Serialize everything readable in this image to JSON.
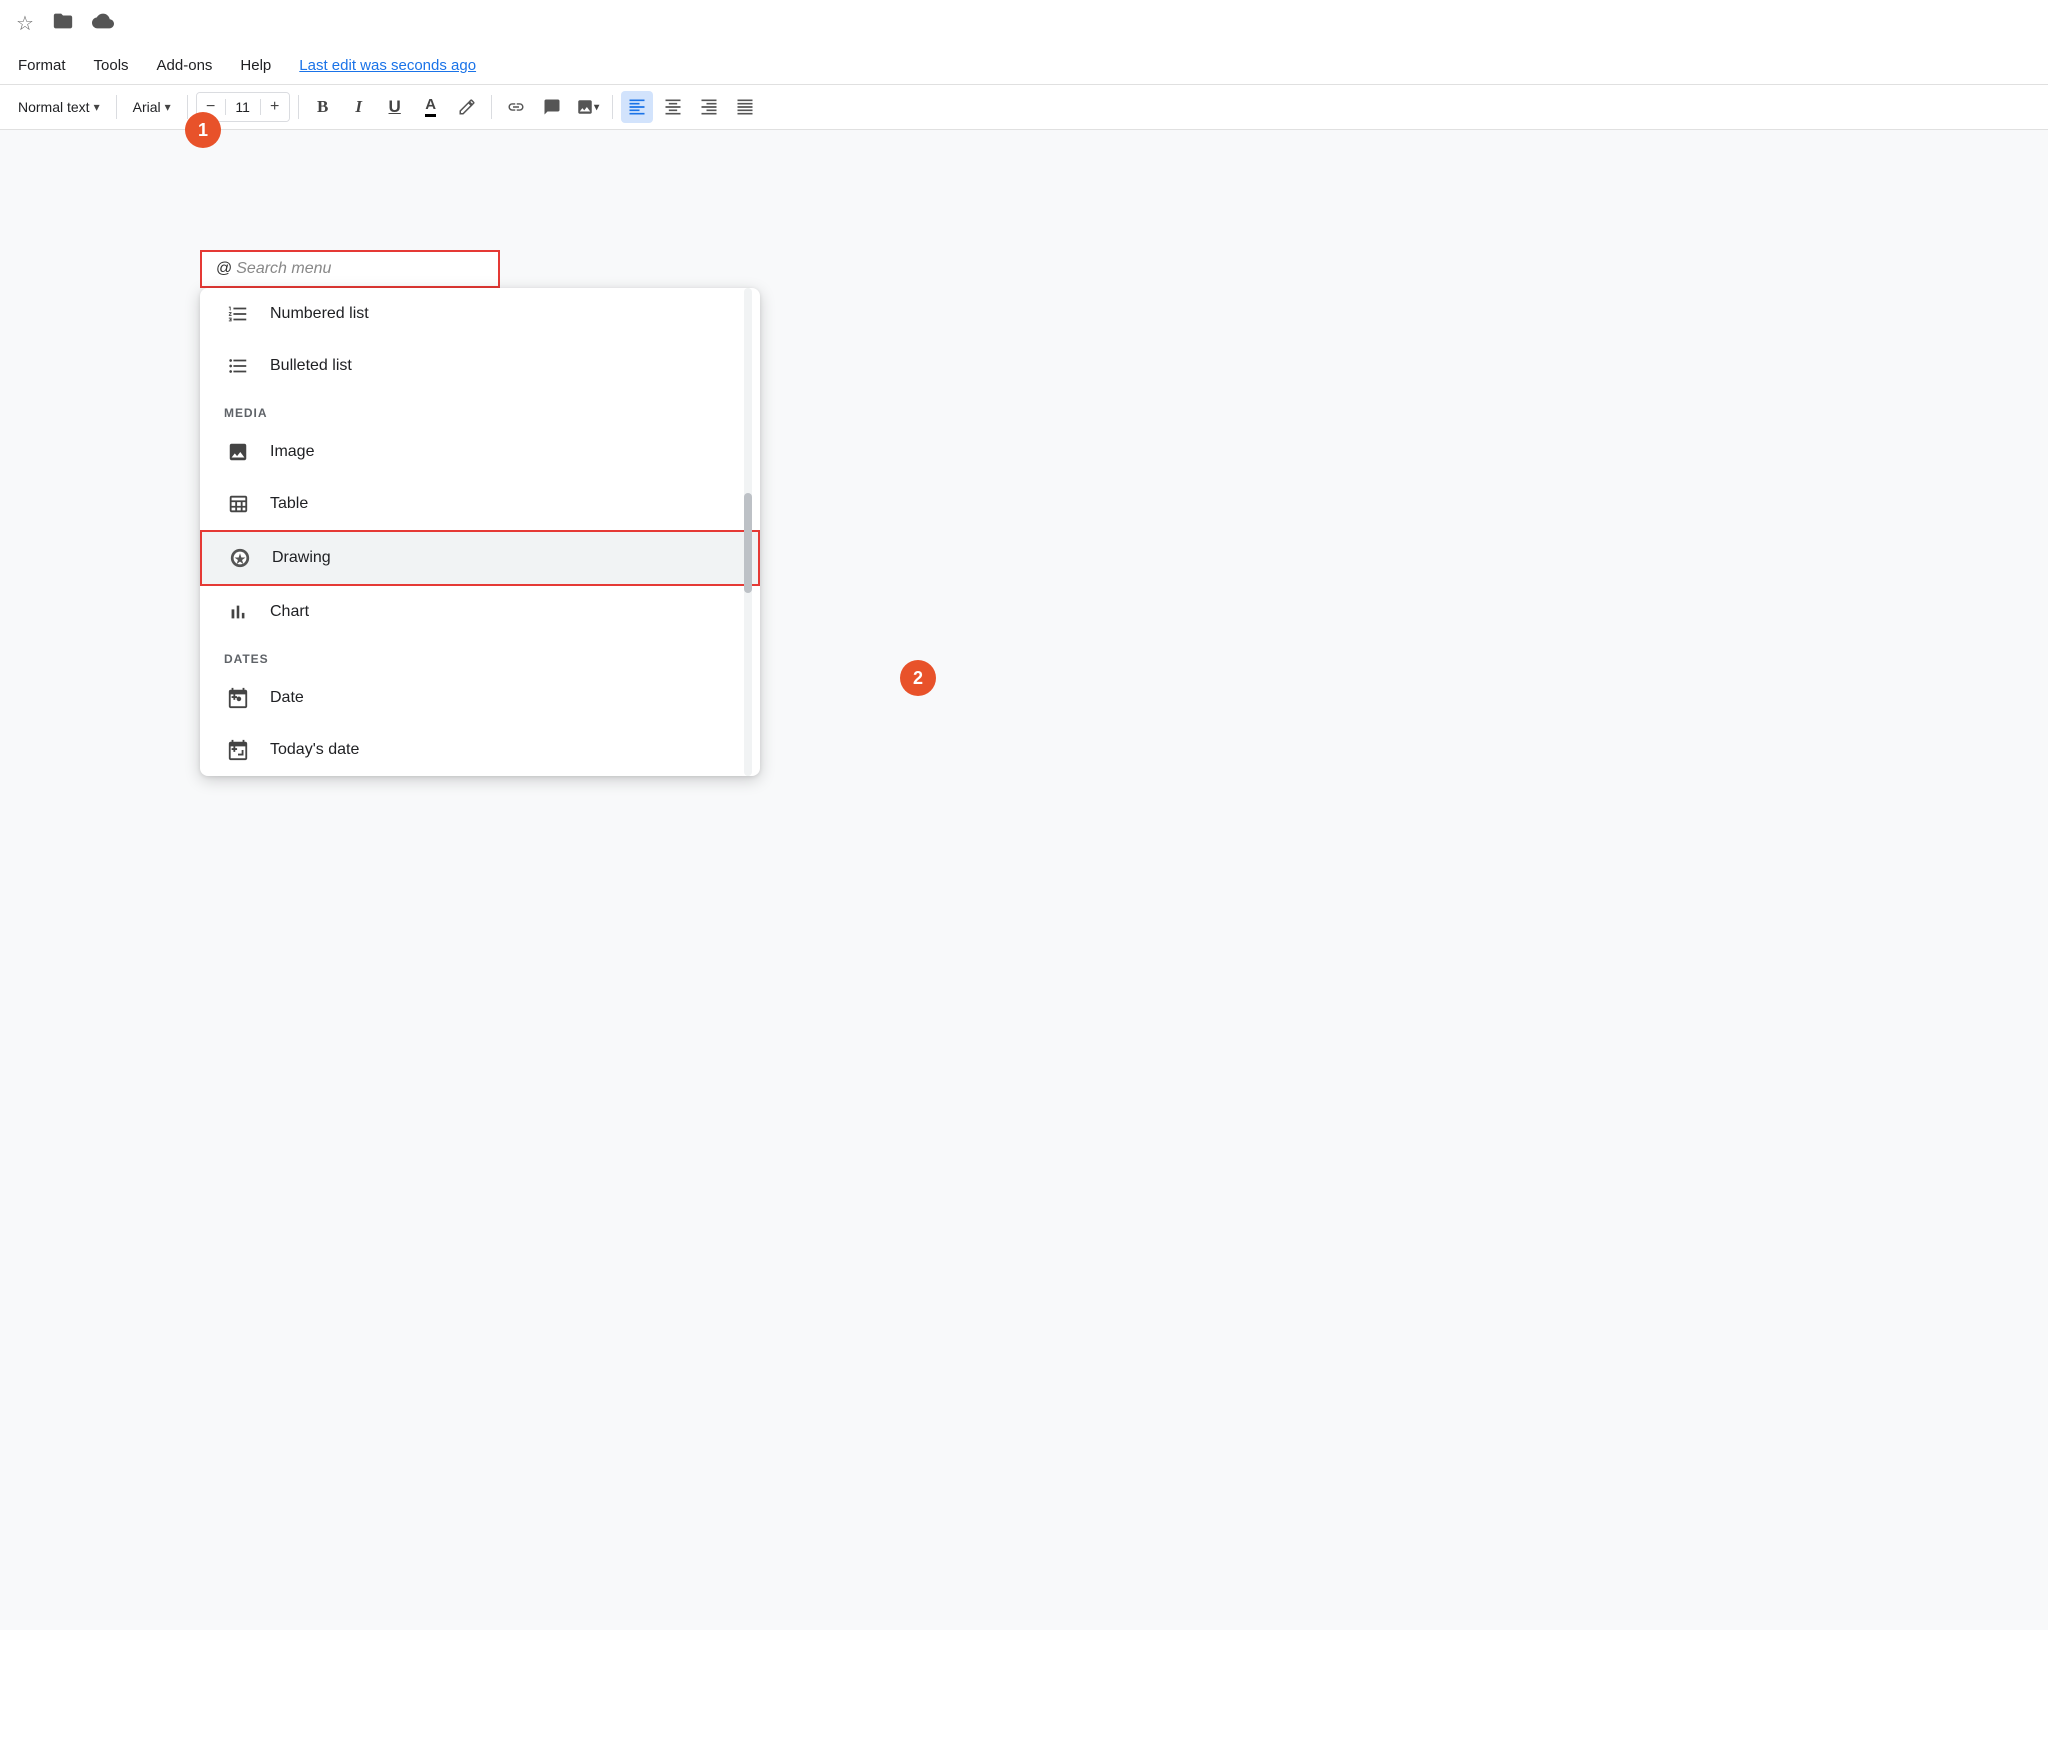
{
  "topIcons": {
    "star": "☆",
    "folder": "📁",
    "cloud": "☁"
  },
  "menuBar": {
    "items": [
      "Format",
      "Tools",
      "Add-ons",
      "Help"
    ],
    "lastEdit": "Last edit was seconds ago"
  },
  "toolbar": {
    "textStyle": "Normal text",
    "font": "Arial",
    "fontSize": "11",
    "bold": "B",
    "italic": "I",
    "underline": "U",
    "fontColorLabel": "A",
    "highlightLabel": "✏",
    "linkLabel": "🔗",
    "commentLabel": "💬",
    "imageLabel": "🖼",
    "alignLeft": "≡",
    "alignCenter": "≡",
    "alignRight": "≡",
    "alignJustify": "≡"
  },
  "annotations": {
    "badge1": "1",
    "badge2": "2"
  },
  "searchBox": {
    "at": "@",
    "placeholder": "Search menu"
  },
  "dropdownMenu": {
    "items": [
      {
        "id": "numbered-list",
        "icon": "numbered-list-icon",
        "label": "Numbered list",
        "section": null,
        "highlighted": false
      },
      {
        "id": "bulleted-list",
        "icon": "bulleted-list-icon",
        "label": "Bulleted list",
        "section": null,
        "highlighted": false
      }
    ],
    "sections": [
      {
        "label": "MEDIA",
        "items": [
          {
            "id": "image",
            "icon": "image-icon",
            "label": "Image",
            "highlighted": false
          },
          {
            "id": "table",
            "icon": "table-icon",
            "label": "Table",
            "highlighted": false
          },
          {
            "id": "drawing",
            "icon": "drawing-icon",
            "label": "Drawing",
            "highlighted": true
          },
          {
            "id": "chart",
            "icon": "chart-icon",
            "label": "Chart",
            "highlighted": false
          }
        ]
      },
      {
        "label": "DATES",
        "items": [
          {
            "id": "date",
            "icon": "date-icon",
            "label": "Date",
            "highlighted": false
          },
          {
            "id": "todays-date",
            "icon": "todays-date-icon",
            "label": "Today's date",
            "highlighted": false
          }
        ]
      }
    ]
  }
}
